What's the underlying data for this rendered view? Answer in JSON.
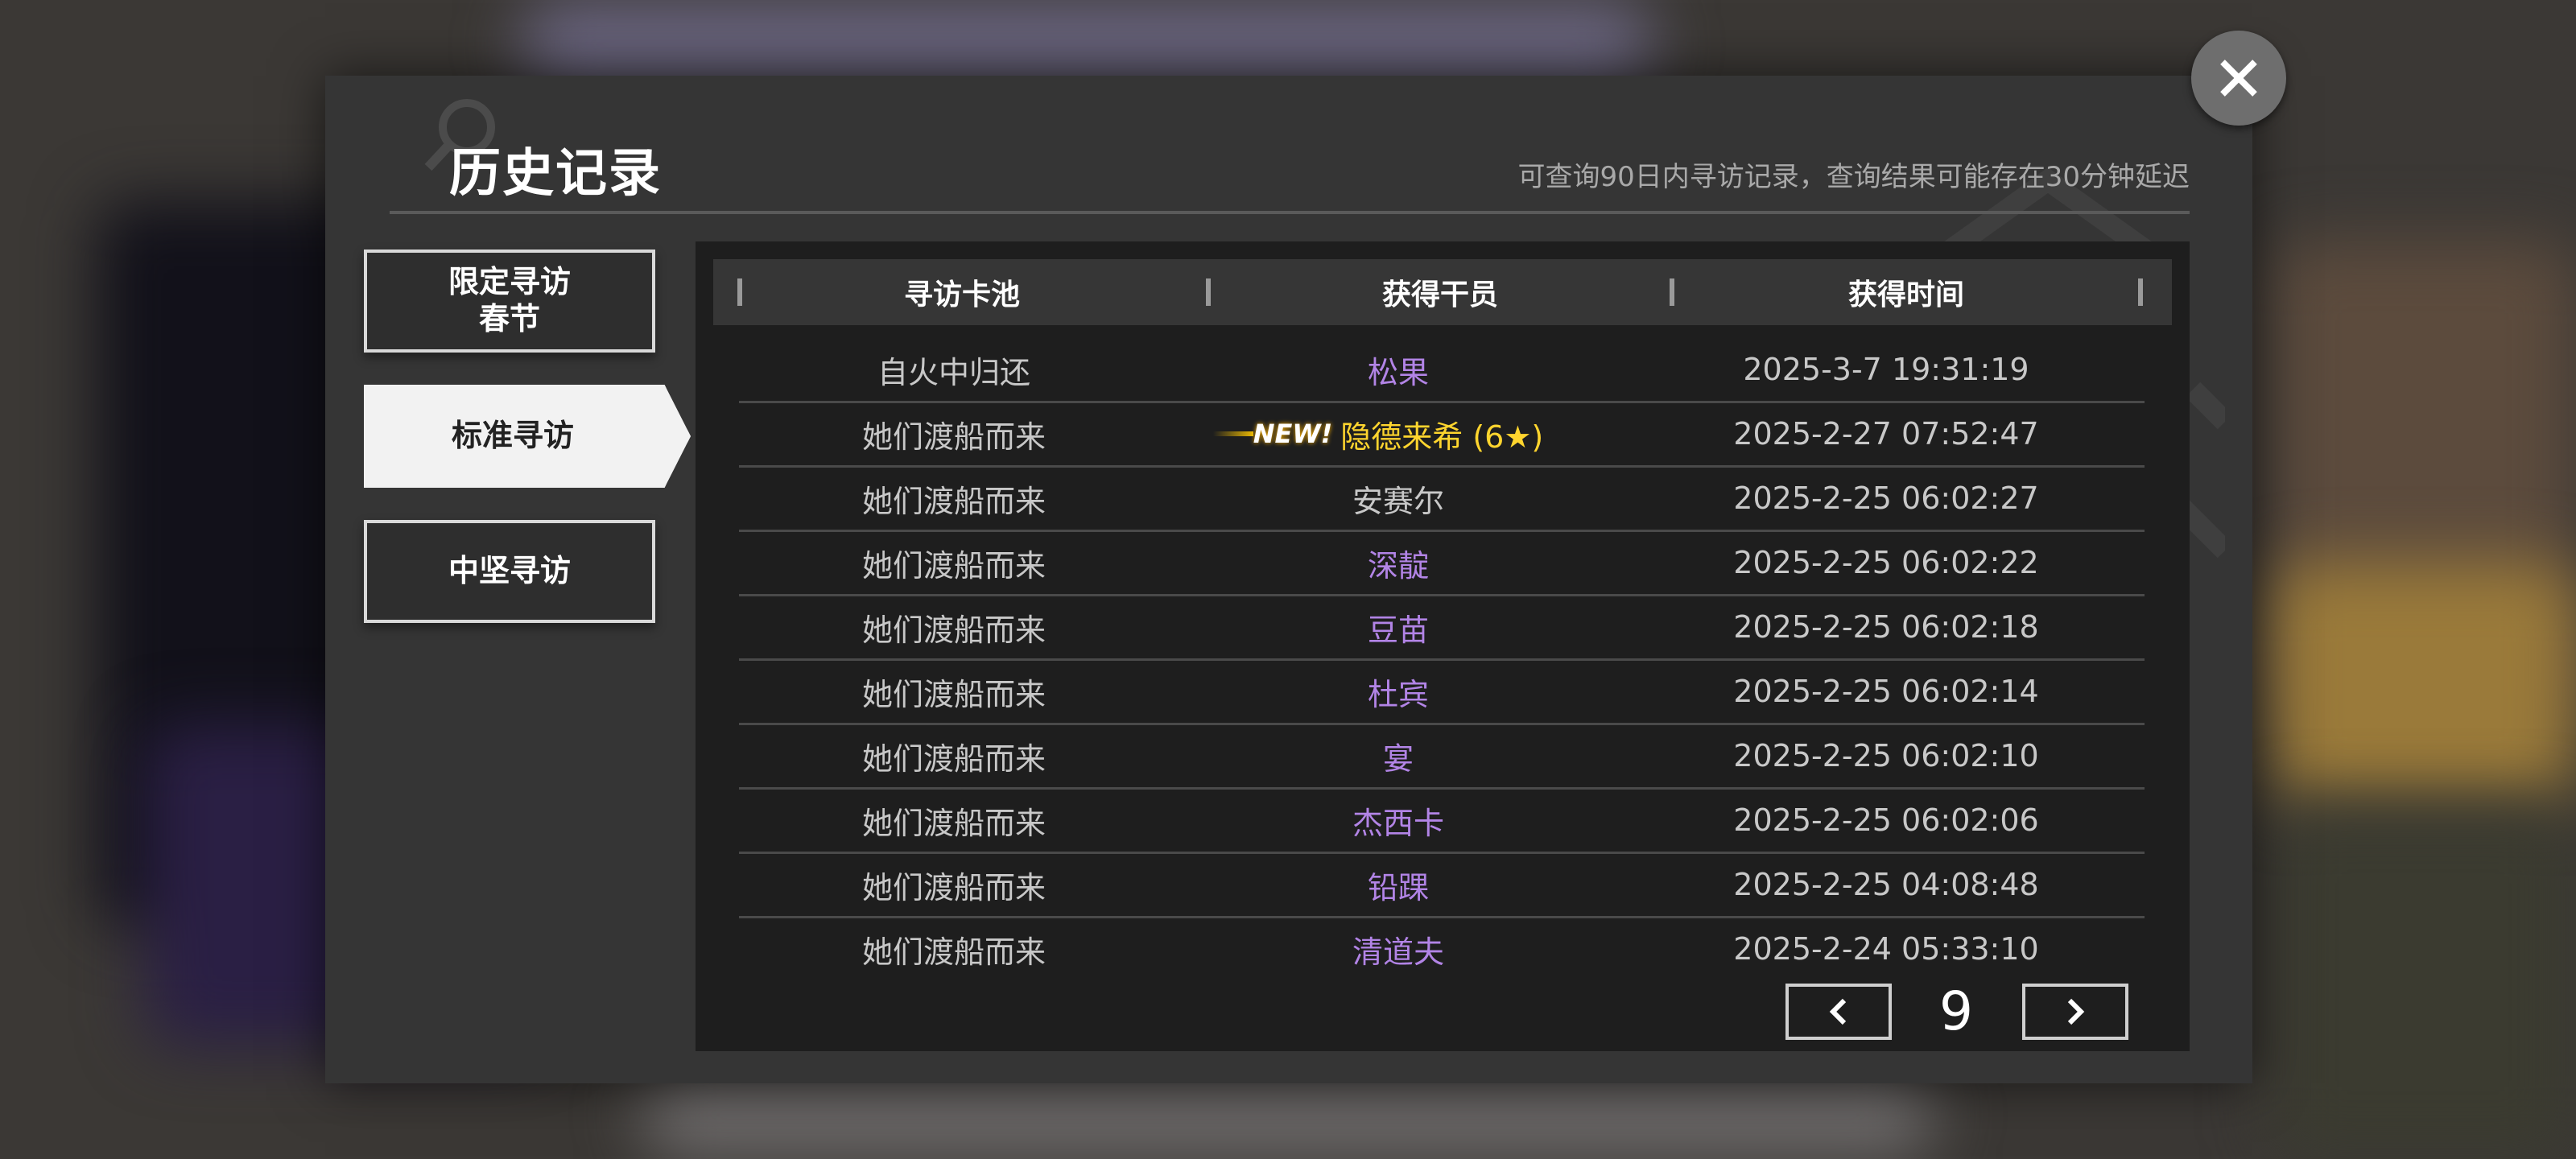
{
  "dialog": {
    "title": "历史记录",
    "hint": "可查询90日内寻访记录，查询结果可能存在30分钟延迟"
  },
  "tabs": [
    {
      "label": "限定寻访\n春节",
      "active": false
    },
    {
      "label": "标准寻访",
      "active": true
    },
    {
      "label": "中坚寻访",
      "active": false
    }
  ],
  "table": {
    "headers": [
      "寻访卡池",
      "获得干员",
      "获得时间"
    ],
    "rows": [
      {
        "pool": "自火中归还",
        "operator": "松果",
        "time": "2025-3-7 19:31:19",
        "rarity_color": "purple"
      },
      {
        "pool": "她们渡船而来",
        "badge": "NEW!",
        "operator": "隐德来希 (6★)",
        "time": "2025-2-27 07:52:47",
        "rarity_color": "gold"
      },
      {
        "pool": "她们渡船而来",
        "operator": "安赛尔",
        "time": "2025-2-25 06:02:27",
        "rarity_color": "grey"
      },
      {
        "pool": "她们渡船而来",
        "operator": "深靛",
        "time": "2025-2-25 06:02:22",
        "rarity_color": "purple"
      },
      {
        "pool": "她们渡船而来",
        "operator": "豆苗",
        "time": "2025-2-25 06:02:18",
        "rarity_color": "purple"
      },
      {
        "pool": "她们渡船而来",
        "operator": "杜宾",
        "time": "2025-2-25 06:02:14",
        "rarity_color": "purple"
      },
      {
        "pool": "她们渡船而来",
        "operator": "宴",
        "time": "2025-2-25 06:02:10",
        "rarity_color": "purple"
      },
      {
        "pool": "她们渡船而来",
        "operator": "杰西卡",
        "time": "2025-2-25 06:02:06",
        "rarity_color": "purple"
      },
      {
        "pool": "她们渡船而来",
        "operator": "铅踝",
        "time": "2025-2-25 04:08:48",
        "rarity_color": "purple"
      },
      {
        "pool": "她们渡船而来",
        "operator": "清道夫",
        "time": "2025-2-24 05:33:10",
        "rarity_color": "purple"
      }
    ]
  },
  "pager": {
    "page": "9",
    "prev_icon": "chevron-left-icon",
    "next_icon": "chevron-right-icon"
  },
  "close_icon": "close-icon",
  "colors": {
    "purple": "#b284e6",
    "gold": "#ffd52e",
    "grey": "#c8c8c8"
  }
}
